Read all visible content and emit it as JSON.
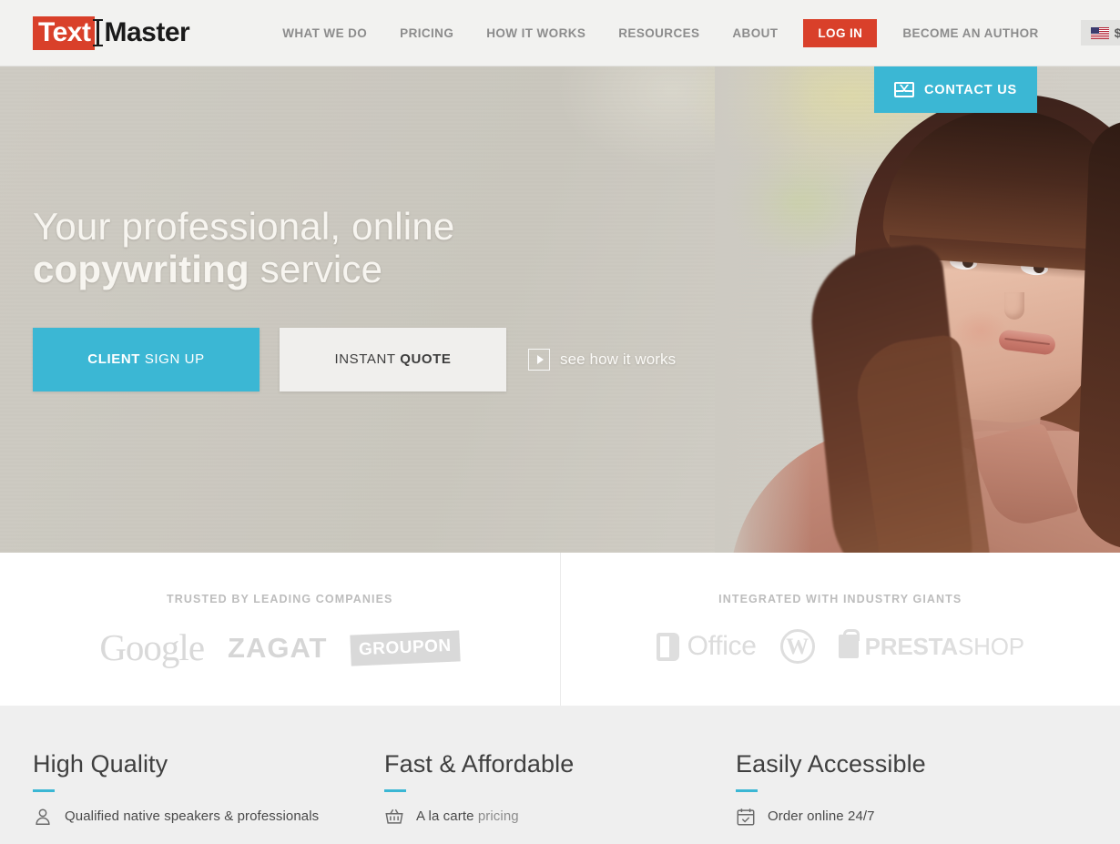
{
  "header": {
    "logo": {
      "text_part": "Text",
      "master_part": "Master",
      "cursor_icon": "text-cursor-icon"
    },
    "nav": [
      {
        "label": "WHAT WE DO",
        "name": "nav-what-we-do"
      },
      {
        "label": "PRICING",
        "name": "nav-pricing"
      },
      {
        "label": "HOW IT WORKS",
        "name": "nav-how-it-works"
      },
      {
        "label": "RESOURCES",
        "name": "nav-resources"
      },
      {
        "label": "ABOUT",
        "name": "nav-about"
      }
    ],
    "login_label": "LOG IN",
    "become_author_label": "BECOME AN AUTHOR",
    "language": {
      "flag": "us-flag-icon",
      "currency": "$"
    },
    "accent_red": "#d9402a"
  },
  "hero": {
    "title_line1": "Your professional, online",
    "title_line2_bold": "copywriting",
    "title_line2_rest": " service",
    "signup_bold": "CLIENT",
    "signup_rest": " SIGN UP",
    "quote_rest": "INSTANT ",
    "quote_bold": "QUOTE",
    "see_how_label": "see how it works",
    "play_icon": "play-icon",
    "contact_label": "CONTACT US",
    "contact_icon": "envelope-icon",
    "accent_teal": "#3bb7d4"
  },
  "logos": {
    "trusted_caption": "TRUSTED BY LEADING COMPANIES",
    "integrated_caption": "INTEGRATED WITH INDUSTRY GIANTS",
    "trusted": [
      {
        "name": "google-logo",
        "label": "Google"
      },
      {
        "name": "zagat-logo",
        "label": "ZAGAT"
      },
      {
        "name": "groupon-logo",
        "label": "GROUPON"
      }
    ],
    "integrated": [
      {
        "name": "microsoft-office-logo",
        "label": "Office"
      },
      {
        "name": "wordpress-logo",
        "label": "W"
      },
      {
        "name": "prestashop-logo",
        "label": "PRESTA",
        "label_light": "SHOP"
      }
    ]
  },
  "features": [
    {
      "title": "High Quality",
      "icon": "person-icon",
      "text": "Qualified native speakers & professionals",
      "link": ""
    },
    {
      "title": "Fast & Affordable",
      "icon": "basket-icon",
      "text": "A la carte ",
      "link": "pricing"
    },
    {
      "title": "Easily Accessible",
      "icon": "calendar-check-icon",
      "text": "Order online 24/7",
      "link": ""
    }
  ]
}
